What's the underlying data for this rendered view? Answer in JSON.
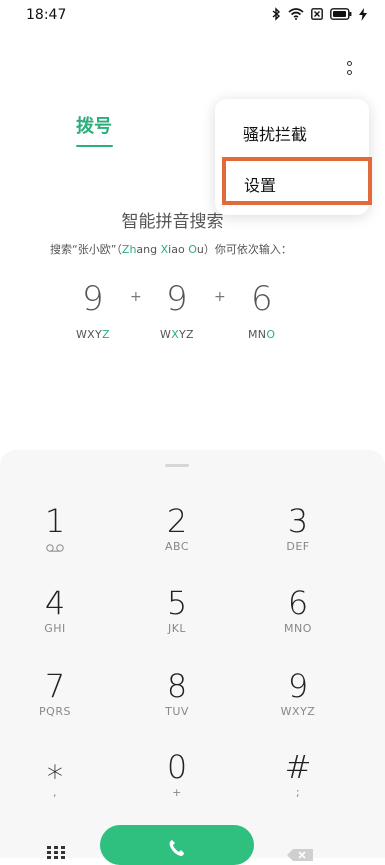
{
  "status": {
    "time": "18:47"
  },
  "tabs": {
    "dial_label": "拨号"
  },
  "menu": {
    "items": [
      "骚扰拦截",
      "设置"
    ]
  },
  "hint": {
    "title": "智能拼音搜索",
    "sub_prefix": "搜索“张小欧”（",
    "sub_zh": "Zh",
    "sub_ang": "ang ",
    "sub_x": "X",
    "sub_iao": "iao ",
    "sub_o": "O",
    "sub_u": "u",
    "sub_suffix": "）你可依次输入："
  },
  "example": {
    "digits": [
      "9",
      "9",
      "6"
    ],
    "plus": "+",
    "letters": [
      {
        "pre": "WXY",
        "hl": "Z",
        "post": ""
      },
      {
        "pre": "W",
        "hl": "X",
        "post": "YZ"
      },
      {
        "pre": "MN",
        "hl": "O",
        "post": ""
      }
    ]
  },
  "keypad": {
    "keys": [
      {
        "num": "1",
        "sub": ""
      },
      {
        "num": "2",
        "sub": "ABC"
      },
      {
        "num": "3",
        "sub": "DEF"
      },
      {
        "num": "4",
        "sub": "GHI"
      },
      {
        "num": "5",
        "sub": "JKL"
      },
      {
        "num": "6",
        "sub": "MNO"
      },
      {
        "num": "7",
        "sub": "PQRS"
      },
      {
        "num": "8",
        "sub": "TUV"
      },
      {
        "num": "9",
        "sub": "WXYZ"
      },
      {
        "num": "⁎",
        "sub": ","
      },
      {
        "num": "0",
        "sub": "+"
      },
      {
        "num": "#",
        "sub": ";"
      }
    ]
  },
  "icons": {
    "voicemail": "voicemail-icon",
    "call": "phone-icon",
    "menu": "grid-menu-icon",
    "backspace": "backspace-icon"
  },
  "colors": {
    "accent": "#2aae7a",
    "call": "#2fbf7f",
    "highlight": "#e06a3c"
  }
}
